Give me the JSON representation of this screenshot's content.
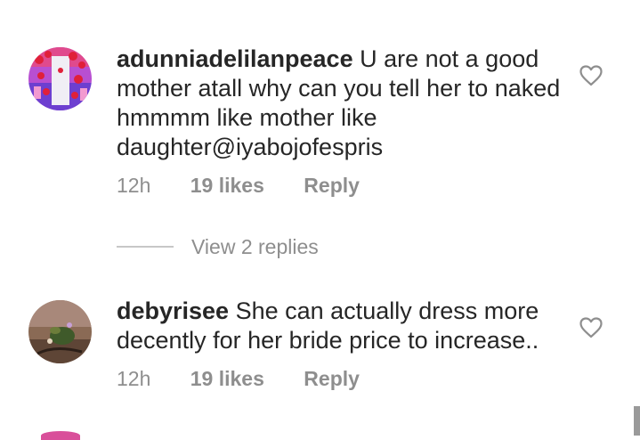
{
  "comments": [
    {
      "username": "adunniadelilanpeace",
      "body": "U are not a good mother atall why can you tell her to naked hmmmm like mother like daughter@iyabojofespris",
      "time": "12h",
      "likes": "19 likes",
      "reply_label": "Reply",
      "avatar_icon": "user-avatar-colorful",
      "view_replies_label": "View 2 replies"
    },
    {
      "username": "debyrisee",
      "body": "She can actually dress more decently for her bride price to increase..",
      "time": "12h",
      "likes": "19 likes",
      "reply_label": "Reply",
      "avatar_icon": "user-avatar-photo"
    }
  ],
  "colors": {
    "text": "#262626",
    "secondary": "#8e8e8e",
    "divider": "#c7c7c7"
  }
}
